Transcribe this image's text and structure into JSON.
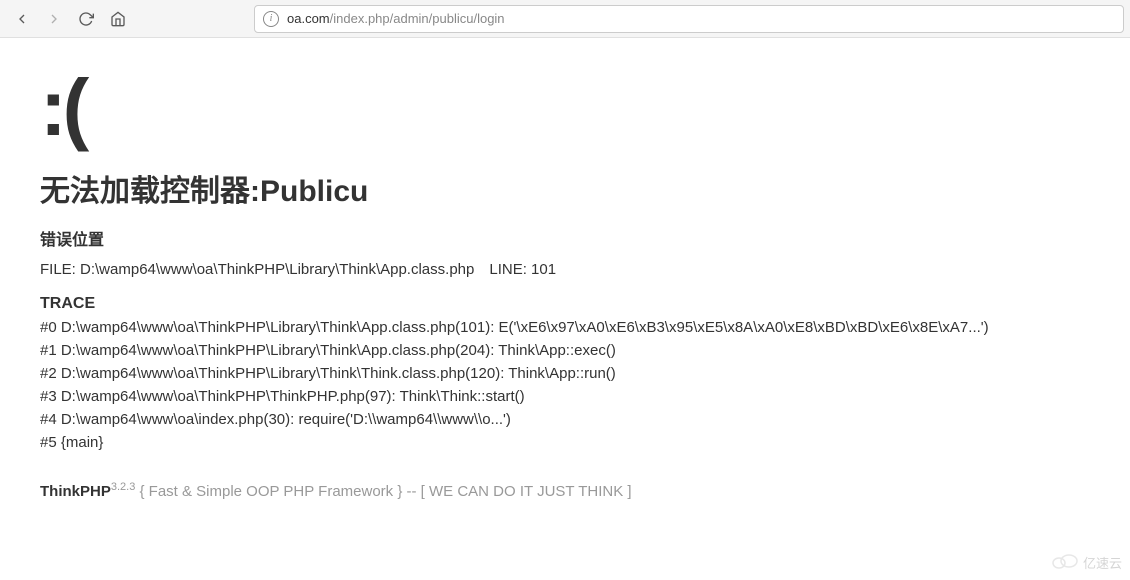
{
  "browser": {
    "url_domain": "oa.com",
    "url_path": "/index.php/admin/publicu/login"
  },
  "error": {
    "sad_face": ":(",
    "title": "无法加载控制器:Publicu",
    "location_label": "错误位置",
    "file_prefix": "FILE: ",
    "file_path": "D:\\wamp64\\www\\oa\\ThinkPHP\\Library\\Think\\App.class.php",
    "line_prefix": "　LINE: ",
    "line_number": "101",
    "trace_label": "TRACE",
    "trace": [
      "#0 D:\\wamp64\\www\\oa\\ThinkPHP\\Library\\Think\\App.class.php(101): E('\\xE6\\x97\\xA0\\xE6\\xB3\\x95\\xE5\\x8A\\xA0\\xE8\\xBD\\xBD\\xE6\\x8E\\xA7...')",
      "#1 D:\\wamp64\\www\\oa\\ThinkPHP\\Library\\Think\\App.class.php(204): Think\\App::exec()",
      "#2 D:\\wamp64\\www\\oa\\ThinkPHP\\Library\\Think\\Think.class.php(120): Think\\App::run()",
      "#3 D:\\wamp64\\www\\oa\\ThinkPHP\\ThinkPHP.php(97): Think\\Think::start()",
      "#4 D:\\wamp64\\www\\oa\\index.php(30): require('D:\\\\wamp64\\\\www\\\\o...')",
      "#5 {main}"
    ]
  },
  "footer": {
    "brand": "ThinkPHP",
    "version": "3.2.3",
    "tagline": " { Fast & Simple OOP PHP Framework } -- [ WE CAN DO IT JUST THINK ]"
  },
  "watermark": {
    "text": "亿速云"
  }
}
